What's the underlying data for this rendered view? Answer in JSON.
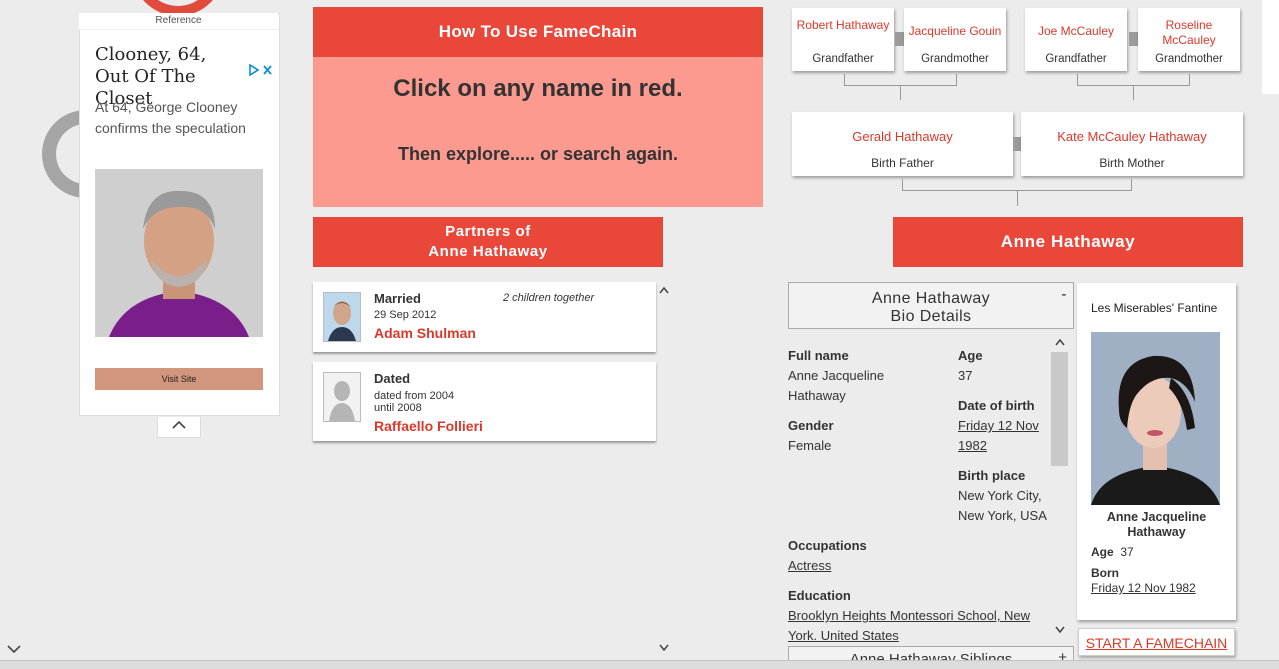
{
  "ad": {
    "reference": "Reference",
    "headline": "Clooney, 64, Out Of The Closet",
    "subtext": "At 64, George Clooney confirms the speculation",
    "button": "Visit Site",
    "collapse_icon": "chevron-up-icon",
    "adchoices_icon": "adchoices-icon"
  },
  "howto": {
    "title": "How To Use FameChain",
    "line1": "Click on any name in red.",
    "line2": "Then explore..... or search again."
  },
  "partners": {
    "title_line1": "Partners of",
    "title_line2": "Anne Hathaway",
    "items": [
      {
        "type": "Married",
        "date": "29 Sep 2012",
        "date2": "",
        "name": "Adam Shulman",
        "note": "2 children together"
      },
      {
        "type": "Dated",
        "date": "dated from 2004",
        "date2": "until 2008",
        "name": "Raffaello Follieri",
        "note": ""
      }
    ]
  },
  "tree": {
    "grandparents": [
      {
        "name": "Robert Hathaway",
        "role": "Grandfather"
      },
      {
        "name": "Jacqueline Gouin",
        "role": "Grandmother"
      },
      {
        "name": "Joe McCauley",
        "role": "Grandfather"
      },
      {
        "name": "Roseline McCauley",
        "role": "Grandmother"
      }
    ],
    "parents": [
      {
        "name": "Gerald Hathaway",
        "role": "Birth Father"
      },
      {
        "name": "Kate McCauley Hathaway",
        "role": "Birth Mother"
      }
    ],
    "celebrity": "Anne Hathaway"
  },
  "bio": {
    "title_line1": "Anne Hathaway",
    "title_line2": "Bio Details",
    "toggle": "-",
    "full_name_label": "Full name",
    "full_name": "Anne Jacqueline Hathaway",
    "age_label": "Age",
    "age": "37",
    "dob_label": "Date of birth",
    "dob": "Friday 12 Nov 1982",
    "gender_label": "Gender",
    "gender": "Female",
    "birthplace_label": "Birth place",
    "birthplace": "New York City, New York, USA",
    "occupations_label": "Occupations",
    "occupations": "Actress",
    "education_label": "Education",
    "education": "Brooklyn Heights Montessori School, New York. United States"
  },
  "siblings": {
    "title": "Anne Hathaway Siblings",
    "toggle": "+"
  },
  "profile": {
    "caption": "Les Miserables' Fantine",
    "name": "Anne Jacqueline Hathaway",
    "age_label": "Age",
    "age": "37",
    "born_label": "Born",
    "born": "Friday 12 Nov 1982"
  },
  "start_button": "START A FAMECHAIN",
  "colors": {
    "accent": "#e8473a",
    "accent_light": "#fd9a8f",
    "link_red": "#d9392b",
    "background": "#ececec"
  }
}
